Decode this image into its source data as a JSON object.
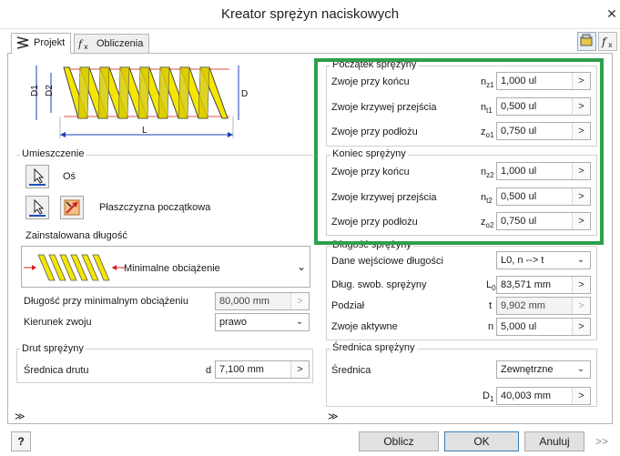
{
  "window": {
    "title": "Kreator sprężyn naciskowych",
    "close_glyph": "✕"
  },
  "tabs": [
    {
      "label": "Projekt"
    },
    {
      "label": "Obliczenia"
    }
  ],
  "diagram": {
    "label_d1": "D1",
    "label_d2": "D2",
    "label_d": "D",
    "label_l": "L"
  },
  "placement": {
    "title": "Umieszczenie",
    "axis_label": "Oś",
    "start_plane_label": "Płaszczyzna początkowa",
    "installed_length_label": "Zainstalowana długość",
    "installed_length_value": "Minimalne obciążenie",
    "min_load_length_label": "Długość przy minimalnym obciążeniu",
    "min_load_length_value": "80,000 mm",
    "coil_direction_label": "Kierunek zwoju",
    "coil_direction_value": "prawo"
  },
  "wire": {
    "title": "Drut sprężyny",
    "diameter_label": "Średnica drutu",
    "diameter_symbol": "d",
    "diameter_value": "7,100 mm"
  },
  "spring_start": {
    "title": "Początek sprężyny",
    "rows": [
      {
        "label": "Zwoje przy końcu",
        "sym": "n",
        "sub": "z1",
        "value": "1,000 ul"
      },
      {
        "label": "Zwoje krzywej przejścia",
        "sym": "n",
        "sub": "t1",
        "value": "0,500 ul"
      },
      {
        "label": "Zwoje przy podłożu",
        "sym": "z",
        "sub": "o1",
        "value": "0,750 ul"
      }
    ]
  },
  "spring_end": {
    "title": "Koniec sprężyny",
    "rows": [
      {
        "label": "Zwoje przy końcu",
        "sym": "n",
        "sub": "z2",
        "value": "1,000 ul"
      },
      {
        "label": "Zwoje krzywej przejścia",
        "sym": "n",
        "sub": "t2",
        "value": "0,500 ul"
      },
      {
        "label": "Zwoje przy podłożu",
        "sym": "z",
        "sub": "o2",
        "value": "0,750 ul"
      }
    ]
  },
  "spring_length": {
    "title": "Długość sprężyny",
    "input_label": "Dane wejściowe długości",
    "input_value": "L0, n --> t",
    "free_length_label": "Dług. swob. sprężyny",
    "free_length_sym": "L",
    "free_length_sub": "0",
    "free_length_value": "83,571 mm",
    "pitch_label": "Podział",
    "pitch_sym": "t",
    "pitch_value": "9,902 mm",
    "active_coils_label": "Zwoje aktywne",
    "active_coils_sym": "n",
    "active_coils_value": "5,000 ul"
  },
  "spring_diameter": {
    "title": "Średnica sprężyny",
    "diameter_label": "Średnica",
    "diameter_type": "Zewnętrzne",
    "d1_sym": "D",
    "d1_sub": "1",
    "d1_value": "40,003 mm"
  },
  "buttons": {
    "help": "?",
    "calculate": "Oblicz",
    "ok": "OK",
    "cancel": "Anuluj",
    "more": ">>"
  },
  "glyphs": {
    "chevron_right": ">",
    "chevron_down": "⌄",
    "double_chevron_down": "≫"
  },
  "colors": {
    "highlight_frame": "#2da04a",
    "spring_yellow": "#f5e600",
    "dim_blue": "#1e3fb5"
  }
}
